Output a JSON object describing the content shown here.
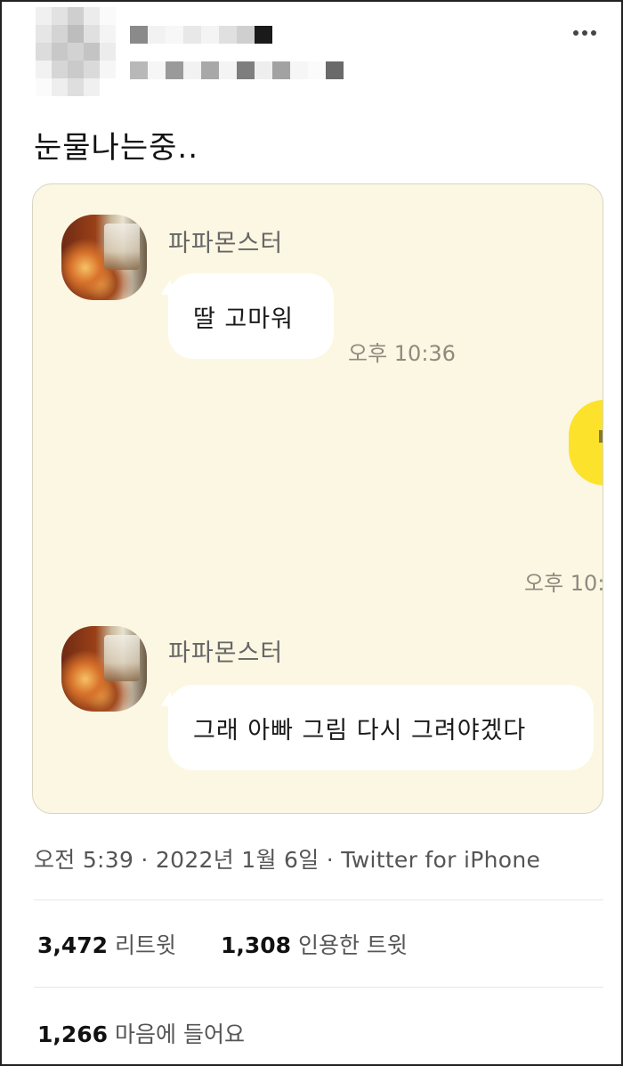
{
  "tweet": {
    "text": "눈물나는중..",
    "timestamp": "오전 5:39 · 2022년 1월 6일 · Twitter for iPhone"
  },
  "chat": {
    "messages": [
      {
        "sender": "파파몬스터",
        "text": "딸 고마워",
        "time": "오후 10:36"
      },
      {
        "sender": "파파몬스터",
        "text": "그래 아빠 그림 다시 그려야겠다"
      }
    ],
    "partial_time": "오후 10:"
  },
  "stats": {
    "retweets_count": "3,472",
    "retweets_label": "리트윗",
    "quotes_count": "1,308",
    "quotes_label": "인용한 트윗",
    "likes_count": "1,266",
    "likes_label": "마음에 들어요"
  },
  "icons": {
    "more": "more-options-icon"
  },
  "colors": {
    "chat_background": "#fcf7e2",
    "my_bubble": "#fde22c",
    "their_bubble": "#ffffff"
  }
}
